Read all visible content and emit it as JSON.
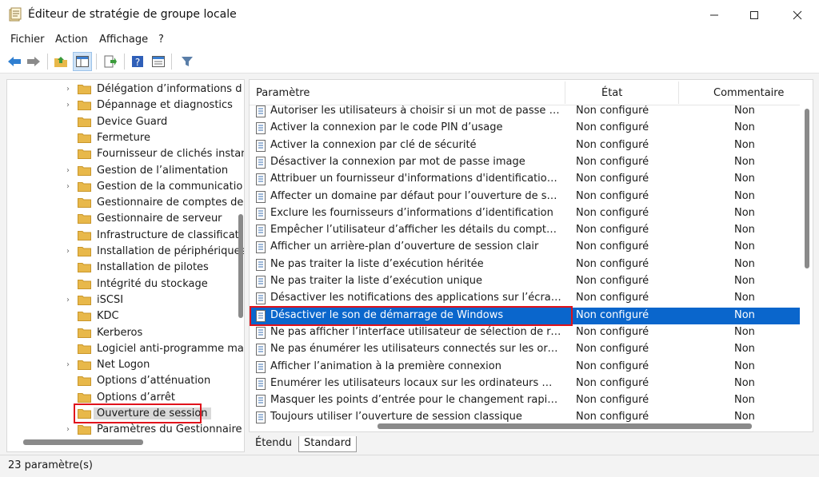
{
  "window": {
    "title": "Éditeur de stratégie de groupe locale",
    "minimize_label": "—",
    "maximize_label": "☐",
    "close_label": "✕"
  },
  "menu": [
    "Fichier",
    "Action",
    "Affichage",
    "?"
  ],
  "tree": {
    "items": [
      {
        "label": "Délégation d’informations d",
        "expandable": true
      },
      {
        "label": "Dépannage et diagnostics",
        "expandable": true
      },
      {
        "label": "Device Guard",
        "expandable": false
      },
      {
        "label": "Fermeture",
        "expandable": false
      },
      {
        "label": "Fournisseur de clichés instan",
        "expandable": false
      },
      {
        "label": "Gestion de l’alimentation",
        "expandable": true
      },
      {
        "label": "Gestion de la communicatio",
        "expandable": true
      },
      {
        "label": "Gestionnaire de comptes de",
        "expandable": false
      },
      {
        "label": "Gestionnaire de serveur",
        "expandable": false
      },
      {
        "label": "Infrastructure de classificati",
        "expandable": false
      },
      {
        "label": "Installation de périphériques",
        "expandable": true
      },
      {
        "label": "Installation de pilotes",
        "expandable": false
      },
      {
        "label": "Intégrité du stockage",
        "expandable": false
      },
      {
        "label": "iSCSI",
        "expandable": true
      },
      {
        "label": "KDC",
        "expandable": false
      },
      {
        "label": "Kerberos",
        "expandable": false
      },
      {
        "label": "Logiciel anti-programme ma",
        "expandable": false
      },
      {
        "label": "Net Logon",
        "expandable": true
      },
      {
        "label": "Options d’atténuation",
        "expandable": false
      },
      {
        "label": "Options d’arrêt",
        "expandable": false
      },
      {
        "label": "Ouverture de session",
        "expandable": false,
        "selected": true
      },
      {
        "label": "Paramètres du Gestionnaire",
        "expandable": true
      }
    ]
  },
  "list": {
    "columns": {
      "name": "Paramètre",
      "state": "État",
      "comment": "Commentaire"
    },
    "rows": [
      {
        "name": "Autoriser les utilisateurs à choisir si un mot de passe est requis",
        "state": "Non configuré",
        "comment": "Non"
      },
      {
        "name": "Activer la connexion par le code PIN d’usage",
        "state": "Non configuré",
        "comment": "Non"
      },
      {
        "name": "Activer la connexion par clé de sécurité",
        "state": "Non configuré",
        "comment": "Non"
      },
      {
        "name": "Désactiver la connexion par mot de passe image",
        "state": "Non configuré",
        "comment": "Non"
      },
      {
        "name": "Attribuer un fournisseur d'informations d'identification par défaut",
        "state": "Non configuré",
        "comment": "Non"
      },
      {
        "name": "Affecter un domaine par défaut pour l’ouverture de session",
        "state": "Non configuré",
        "comment": "Non"
      },
      {
        "name": "Exclure les fournisseurs d’informations d’identification",
        "state": "Non configuré",
        "comment": "Non"
      },
      {
        "name": "Empêcher l’utilisateur d’afficher les détails du compte à la connexion",
        "state": "Non configuré",
        "comment": "Non"
      },
      {
        "name": "Afficher un arrière-plan d’ouverture de session clair",
        "state": "Non configuré",
        "comment": "Non"
      },
      {
        "name": "Ne pas traiter la liste d’exécution héritée",
        "state": "Non configuré",
        "comment": "Non"
      },
      {
        "name": "Ne pas traiter la liste d’exécution unique",
        "state": "Non configuré",
        "comment": "Non"
      },
      {
        "name": "Désactiver les notifications des applications sur l’écran de verrouillage",
        "state": "Non configuré",
        "comment": "Non"
      },
      {
        "name": "Désactiver le son de démarrage de Windows",
        "state": "Non configuré",
        "comment": "Non",
        "selected": true
      },
      {
        "name": "Ne pas afficher l’interface utilisateur de sélection de réseau",
        "state": "Non configuré",
        "comment": "Non"
      },
      {
        "name": "Ne pas énumérer les utilisateurs connectés sur les ordinateurs joints",
        "state": "Non configuré",
        "comment": "Non"
      },
      {
        "name": "Afficher l’animation à la première connexion",
        "state": "Non configuré",
        "comment": "Non"
      },
      {
        "name": "Énumérer les utilisateurs locaux sur les ordinateurs membres d’un domaine",
        "state": "Non configuré",
        "comment": "Non"
      },
      {
        "name": "Masquer les points d’entrée pour le changement rapide d’utilisateur",
        "state": "Non configuré",
        "comment": "Non"
      },
      {
        "name": "Toujours utiliser l’ouverture de session classique",
        "state": "Non configuré",
        "comment": "Non"
      }
    ]
  },
  "tabs": [
    "Étendu",
    "Standard"
  ],
  "active_tab": "Standard",
  "status": "23 paramètre(s)",
  "colors": {
    "selection": "#0a66cc",
    "highlight": "#e0121b",
    "folder": "#e8b84a"
  }
}
